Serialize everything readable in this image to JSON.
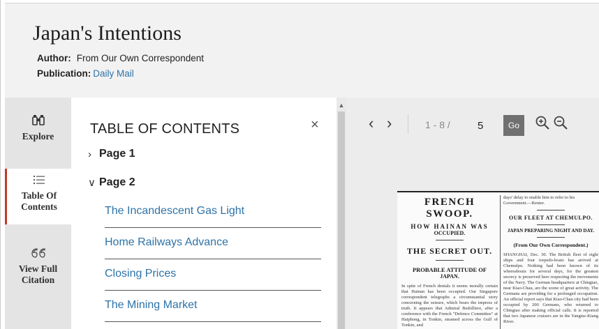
{
  "article": {
    "title": "Japan's Intentions",
    "author_label": "Author:",
    "author": "From Our Own Correspondent",
    "publication_label": "Publication:",
    "publication": "Daily Mail"
  },
  "sidebar": {
    "items": [
      {
        "label": "Explore",
        "icon": "binoculars-icon"
      },
      {
        "label": "Table Of Contents",
        "icon": "list-icon"
      },
      {
        "label": "View Full Citation",
        "icon": "quote-icon"
      }
    ]
  },
  "toc": {
    "heading": "TABLE OF CONTENTS",
    "close_glyph": "×",
    "pages": [
      {
        "label": "Page 1",
        "expanded": false
      },
      {
        "label": "Page 2",
        "expanded": true
      }
    ],
    "items": [
      "The Incandescent Gas Light",
      "Home Railways Advance",
      "Closing Prices",
      "The Mining Market"
    ]
  },
  "viewer": {
    "page_count": "1 - 8 /",
    "page_input": "5",
    "go_label": "Go",
    "newspaper": {
      "col1_headline": "FRENCH SWOOP.",
      "col1_sub1": "HOW HAINAN WAS",
      "col1_sub2": "OCCUPIED.",
      "col1_sub3": "THE SECRET OUT.",
      "col1_sub4": "PROBABLE ATTITUDE OF",
      "col1_sub5": "JAPAN.",
      "col1_body": "In spite of French denials it seems morally certain that Hainan has been occupied. Our Singapore correspondent telegraphs a circumstantial story concerning the seizure, which bears the impress of truth. It appears that Admiral Bedolliere, after a conference with the French \"Defence Committee\" at Haiphong, in Tonkin, steamed across the Gulf of Tonkin, and",
      "col2_lead": "days' delay to enable him to refer to his Government.—Reuter.",
      "col2_headline": "OUR FLEET AT CHEMULPO.",
      "col2_sub": "JAPAN PREPARING NIGHT AND DAY.",
      "col2_byline": "(From Our Own Correspondent.)",
      "col2_body": "SHANGHAI, Dec. 30. The British fleet of eight ships and four torpedo-boats has arrived at Chemulpo. Nothing had been known of its whereabouts for several days, for the greatest secrecy is preserved here respecting the movements of the Navy. The German headquarters at Chingtao, near Kiao-Chau, are the scene of great activity. The Germans are providing for a prolonged occupation. An official report says that Kiao-Chau city had been occupied by 200 Germans, who returned to Chingtao after making official calls. It is reported that two Japanese cruisers are in the Yangtse-Kiang River."
    }
  }
}
